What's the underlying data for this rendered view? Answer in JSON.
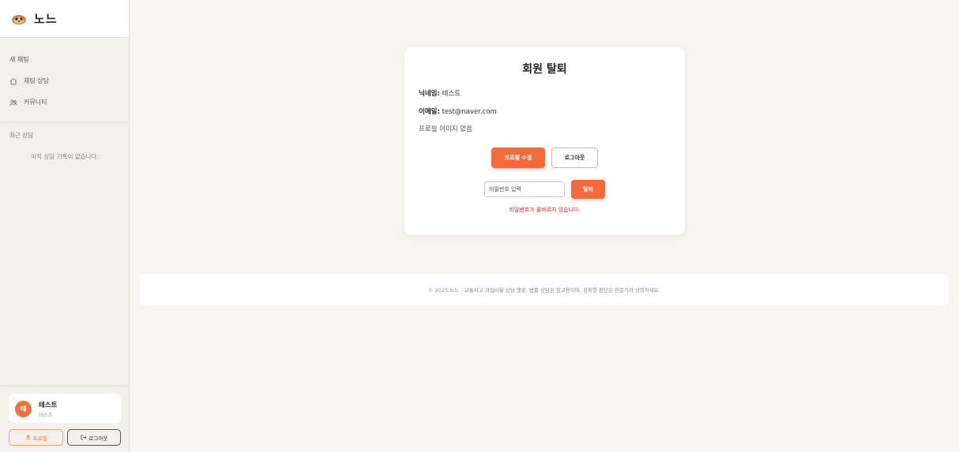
{
  "brand": {
    "name": "노느",
    "logo_icon": "meerkat-logo-icon"
  },
  "sidebar": {
    "new_chat": "새 채팅",
    "nav": [
      {
        "label": "채팅 상담",
        "icon": "home-icon"
      },
      {
        "label": "커뮤니티",
        "icon": "users-icon"
      }
    ],
    "recent_heading": "최근 상담",
    "empty_history": "아직 상담 기록이 없습니다.",
    "user": {
      "avatar_initial": "테",
      "name": "테스트",
      "sub": "테스트"
    },
    "profile_button": "프로필",
    "logout_button": "로그아웃"
  },
  "card": {
    "title": "회원 탈퇴",
    "nickname_label": "닉네임:",
    "nickname_value": "테스트",
    "email_label": "이메일:",
    "email_value": "test@naver.com",
    "no_image": "프로필 이미지 없음",
    "edit_profile_button": "프로필 수정",
    "logout_button": "로그아웃",
    "password_placeholder": "비밀번호 입력",
    "withdraw_button": "탈퇴",
    "error_message": "비밀번호가 올바르지 않습니다."
  },
  "footer": {
    "text": "© 2025 노느 - 교통사고 과실비율 상담 챗봇. 법률 상담은 참고용이며, 정확한 판단은 전문가와 상의하세요."
  },
  "colors": {
    "accent": "#f36b3b",
    "error": "#e02424",
    "background": "#f7f5f0"
  }
}
